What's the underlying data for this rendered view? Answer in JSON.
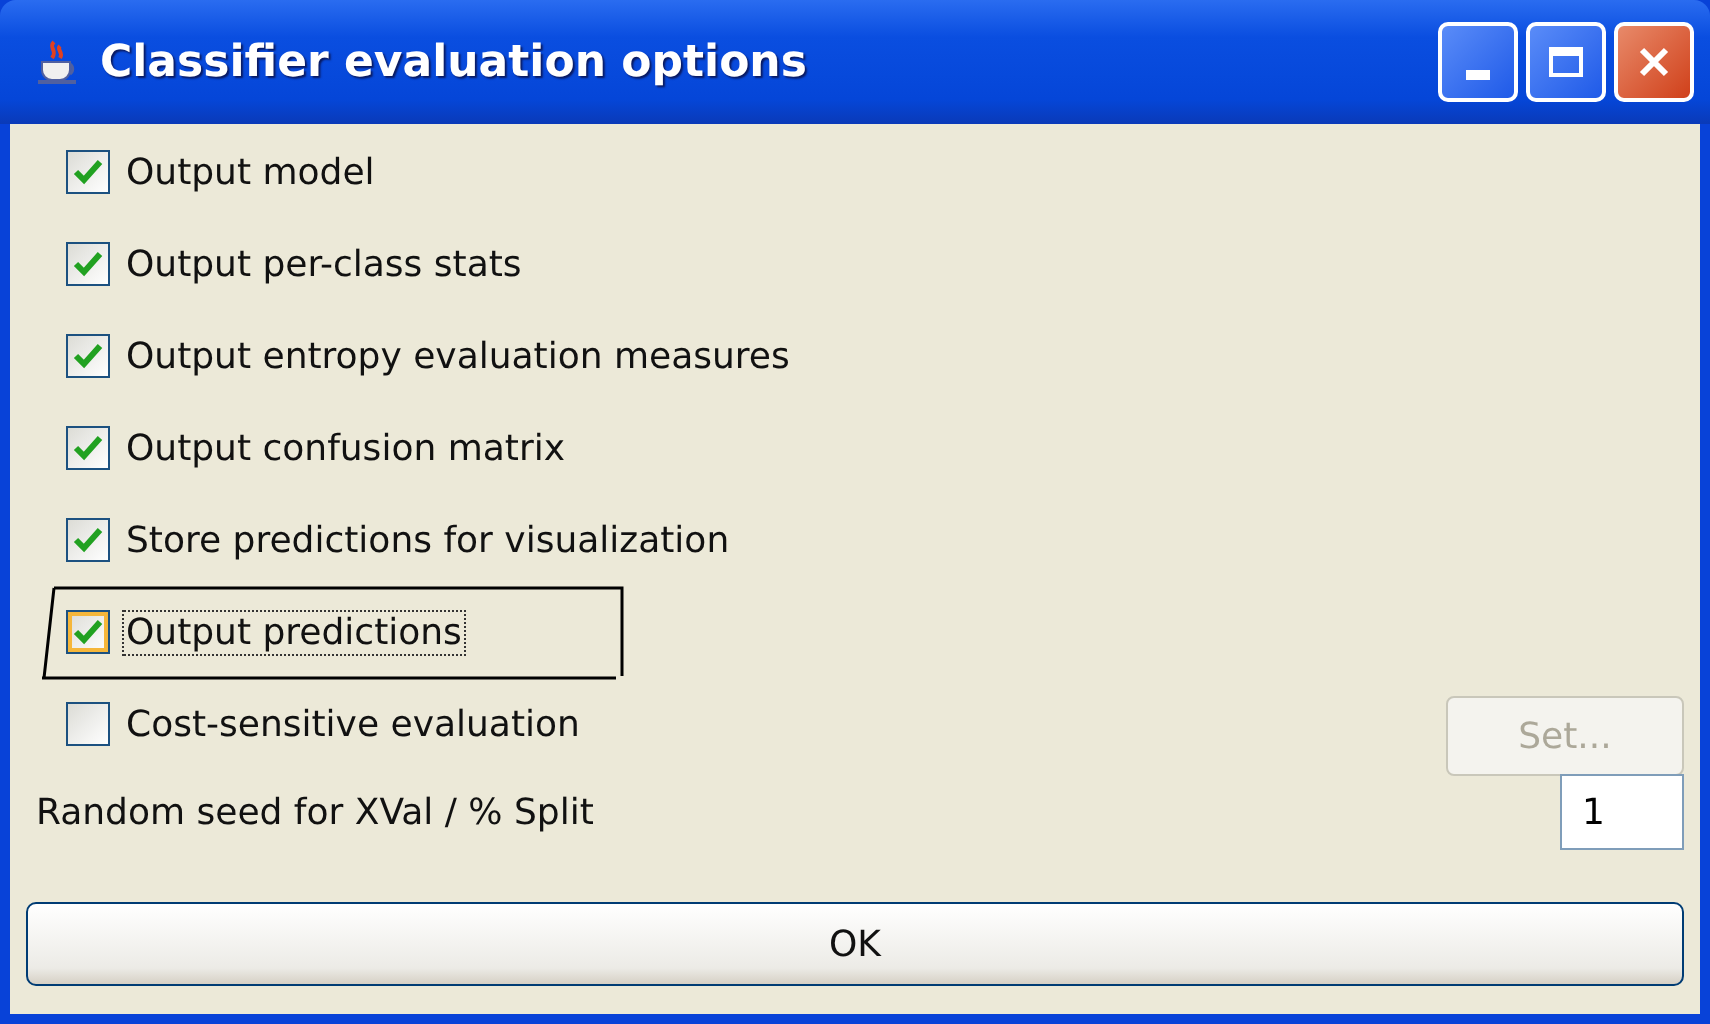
{
  "window": {
    "title": "Classifier evaluation options"
  },
  "options": [
    {
      "label": "Output model",
      "checked": true,
      "focused": false
    },
    {
      "label": "Output per-class stats",
      "checked": true,
      "focused": false
    },
    {
      "label": "Output entropy evaluation measures",
      "checked": true,
      "focused": false
    },
    {
      "label": "Output confusion matrix",
      "checked": true,
      "focused": false
    },
    {
      "label": "Store predictions for visualization",
      "checked": true,
      "focused": false
    },
    {
      "label": "Output predictions",
      "checked": true,
      "focused": true,
      "highlighted": true
    },
    {
      "label": "Cost-sensitive evaluation",
      "checked": false,
      "focused": false
    }
  ],
  "set_button": {
    "label": "Set...",
    "disabled": true
  },
  "seed": {
    "label": "Random seed for XVal / % Split",
    "value": "1"
  },
  "ok_button": {
    "label": "OK"
  }
}
